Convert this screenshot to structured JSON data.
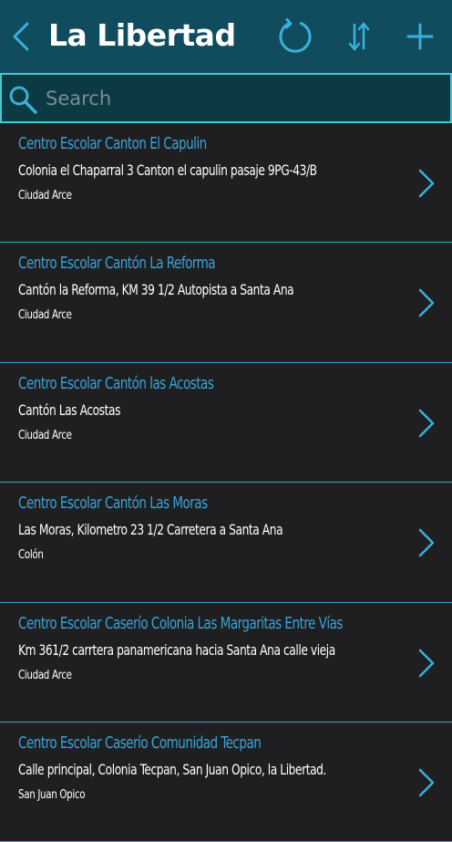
{
  "header": {
    "title": "La Libertad",
    "back_icon": "chevron-left-icon",
    "refresh_icon": "refresh-icon",
    "sort_icon": "sort-icon",
    "add_icon": "plus-icon",
    "background_color": "#114c5e",
    "icon_color": "#3ab0dc"
  },
  "search": {
    "placeholder": "Search",
    "value": "",
    "icon": "search-icon"
  },
  "items": [
    {
      "name": "Centro Escolar Canton El Capulin",
      "address": "Colonia el Chaparral 3 Canton el capulin pasaje 9PG-43/B",
      "city": "Ciudad Arce"
    },
    {
      "name": "Centro Escolar Cantón La Reforma",
      "address": "Cantón la Reforma, KM 39 1/2 Autopista a Santa Ana",
      "city": "Ciudad Arce"
    },
    {
      "name": "Centro Escolar Cantón las Acostas",
      "address": "Cantón Las Acostas",
      "city": "Ciudad Arce"
    },
    {
      "name": "Centro Escolar Cantón Las Moras",
      "address": "Las Moras, Kilometro 23 1/2 Carretera a Santa Ana",
      "city": "Colón"
    },
    {
      "name": "Centro Escolar Caserío Colonia Las Margaritas Entre Vías",
      "address": "Km 361/2 carrtera panamericana hacia Santa Ana calle vieja",
      "city": "Ciudad Arce"
    },
    {
      "name": "Centro Escolar Caserío Comunidad Tecpan",
      "address": "Calle principal, Colonia Tecpan, San Juan Opico, la Libertad.",
      "city": "San Juan Opico"
    }
  ],
  "colors": {
    "accent": "#39a3d9",
    "list_background": "#1f1f21",
    "divider": "#3aa6c4"
  }
}
